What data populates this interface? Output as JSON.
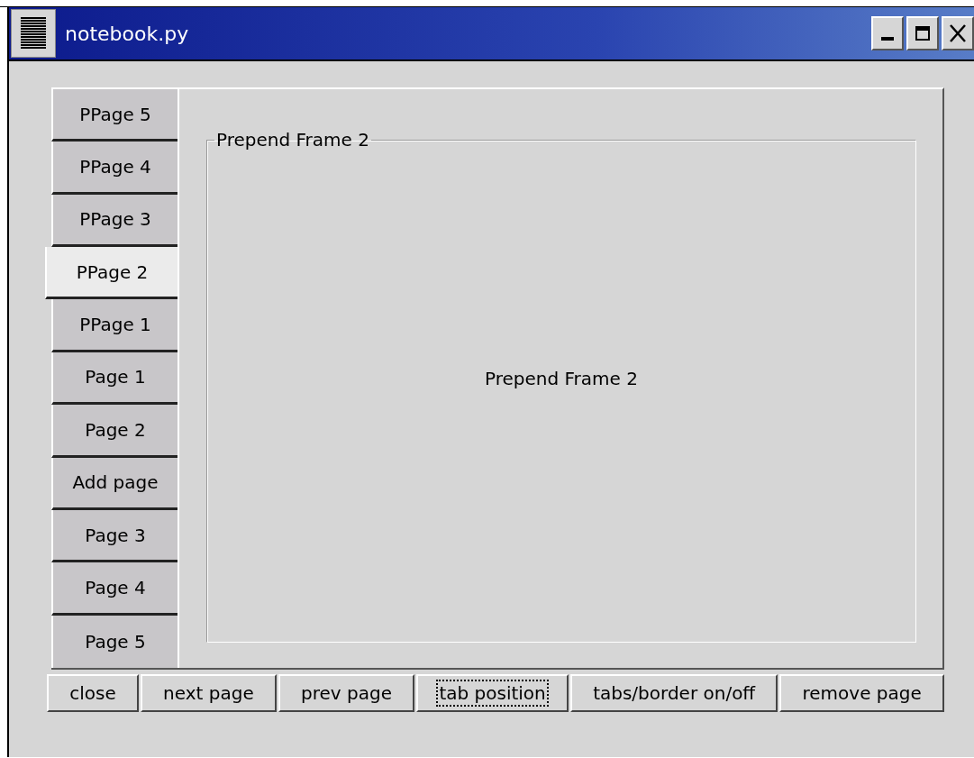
{
  "window": {
    "title": "notebook.py"
  },
  "tabs": [
    {
      "label": "PPage 5",
      "selected": false
    },
    {
      "label": "PPage 4",
      "selected": false
    },
    {
      "label": "PPage 3",
      "selected": false
    },
    {
      "label": "PPage 2",
      "selected": true
    },
    {
      "label": "PPage 1",
      "selected": false
    },
    {
      "label": "Page 1",
      "selected": false
    },
    {
      "label": "Page 2",
      "selected": false
    },
    {
      "label": "Add page",
      "selected": false
    },
    {
      "label": "Page 3",
      "selected": false
    },
    {
      "label": "Page 4",
      "selected": false
    },
    {
      "label": "Page 5",
      "selected": false
    }
  ],
  "page": {
    "frame_label": "Prepend Frame 2",
    "content": "Prepend Frame 2"
  },
  "buttons": [
    {
      "label": "close",
      "focused": false
    },
    {
      "label": "next page",
      "focused": false
    },
    {
      "label": "prev page",
      "focused": false
    },
    {
      "label": "tab position",
      "focused": true
    },
    {
      "label": "tabs/border on/off",
      "focused": false
    },
    {
      "label": "remove page",
      "focused": false
    }
  ]
}
